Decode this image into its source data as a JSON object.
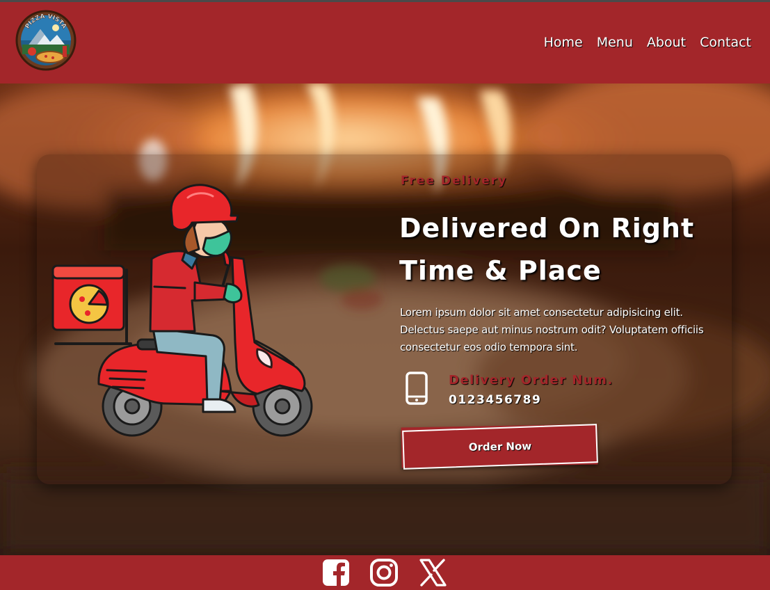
{
  "brand": {
    "logo_text": "PIZZA VISTA"
  },
  "nav": {
    "items": [
      "Home",
      "Menu",
      "About",
      "Contact"
    ]
  },
  "hero": {
    "tagline": "Free Delivery",
    "headline": "Delivered On Right Time & Place",
    "body": "Lorem ipsum dolor sit amet consectetur adipisicing elit. Delectus saepe aut minus nostrum odit? Voluptatem officiis consectetur eos odio tempora sint.",
    "contact_label": "Delivery Order Num.",
    "contact_number": "0123456789",
    "cta_label": "Order Now"
  },
  "footer": {
    "social": [
      "facebook-icon",
      "instagram-icon",
      "x-icon"
    ]
  },
  "colors": {
    "brand_red": "#a3262a",
    "text": "#ffffff"
  }
}
